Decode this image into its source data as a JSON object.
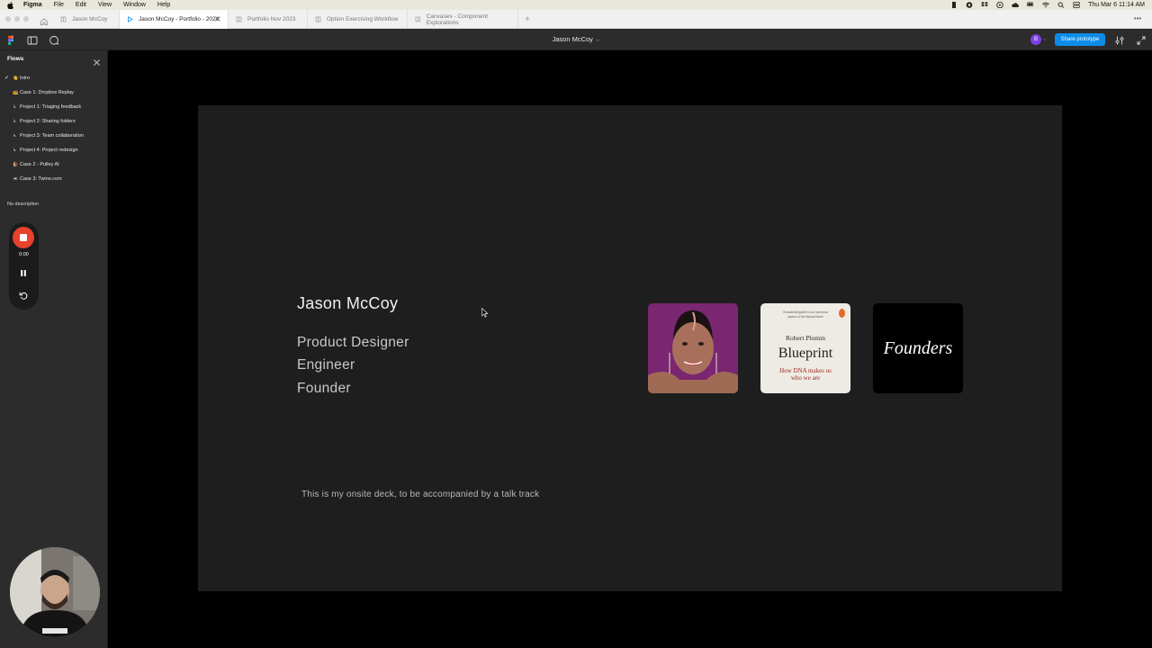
{
  "menubar": {
    "app_name": "Figma",
    "items": [
      "File",
      "Edit",
      "View",
      "Window",
      "Help"
    ],
    "clock": "Thu Mar 6  11:14 AM"
  },
  "tabs": [
    {
      "label": "Jason McCoy",
      "active": false
    },
    {
      "label": "Jason McCoy - Portfolio - 2024",
      "active": true
    },
    {
      "label": "Portfolio Nov 2023",
      "active": false
    },
    {
      "label": "Option Exercising Workflow",
      "active": false
    },
    {
      "label": "Canvases - Component Explorations",
      "active": false
    }
  ],
  "toolbar": {
    "doc_title": "Jason McCoy",
    "avatar_initial": "B",
    "avatar_color": "#7b3fe4",
    "share_label": "Share prototype",
    "accent": "#0c8ce9"
  },
  "sidebar": {
    "title": "Flows",
    "flows": [
      {
        "icon": "👋",
        "label": "Intro",
        "checked": true
      },
      {
        "icon": "📻",
        "label": "Case 1: Dropbox Replay",
        "checked": false
      },
      {
        "icon": "↳",
        "label": "Project 1: Triaging feedback",
        "checked": false
      },
      {
        "icon": "↳",
        "label": "Project 2: Sharing folders",
        "checked": false
      },
      {
        "icon": "↳",
        "label": "Project 3: Team collaboration",
        "checked": false
      },
      {
        "icon": "↳",
        "label": "Project 4: Project redesign",
        "checked": false
      },
      {
        "icon": "🐌",
        "label": "Case 2 - Pulley AI",
        "checked": false
      },
      {
        "icon": "📼",
        "label": "Case 3: Twine.com",
        "checked": false
      }
    ],
    "description": "No description"
  },
  "recorder": {
    "time": "0:00",
    "stop_color": "#e8412c"
  },
  "slide": {
    "name": "Jason McCoy",
    "roles": [
      "Product Designer",
      "Engineer",
      "Founder"
    ],
    "note": "This is my onsite deck, to be accompanied by a talk track",
    "book": {
      "blurb": "A masterful guide to our conscious aspects of the human future",
      "author": "Robert Plomin",
      "title": "Blueprint",
      "subtitle": "How DNA makes us who we are"
    },
    "founders_logo": "Founders"
  }
}
